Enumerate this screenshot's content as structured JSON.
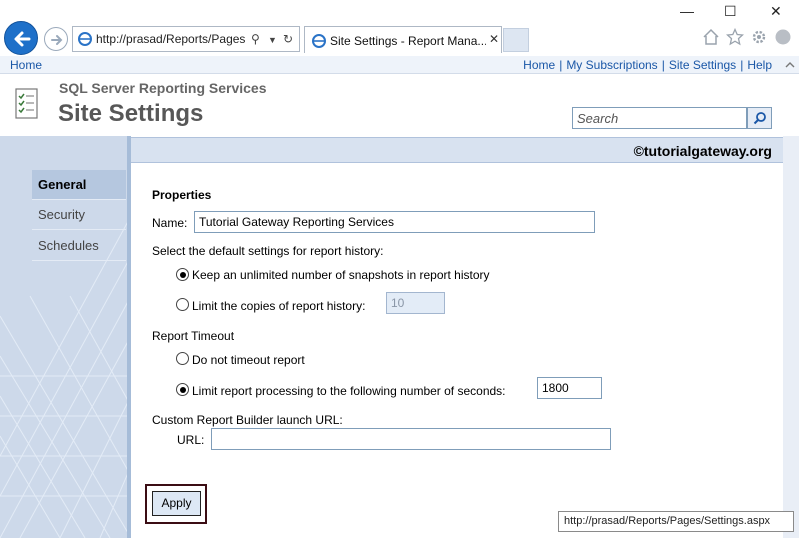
{
  "browser": {
    "address_url": "http://prasad/Reports/Pages",
    "tab_title": "Site Settings - Report Mana...",
    "status_url": "http://prasad/Reports/Pages/Settings.aspx"
  },
  "nav": {
    "left_link": "Home",
    "right_links": [
      "Home",
      "My Subscriptions",
      "Site Settings",
      "Help"
    ]
  },
  "header": {
    "product": "SQL Server Reporting Services",
    "title": "Site Settings",
    "search_placeholder": "Search"
  },
  "sidebar": {
    "items": [
      {
        "label": "General",
        "active": true
      },
      {
        "label": "Security",
        "active": false
      },
      {
        "label": "Schedules",
        "active": false
      }
    ]
  },
  "banner": {
    "watermark": "©tutorialgateway.org"
  },
  "form": {
    "section_title": "Properties",
    "name_label": "Name:",
    "name_value": "Tutorial Gateway Reporting Services",
    "history_label": "Select the default settings for report history:",
    "history_opt_unlimited": "Keep an unlimited number of snapshots in report history",
    "history_opt_limit": "Limit the copies of report history:",
    "history_limit_value": "10",
    "timeout_label": "Report Timeout",
    "timeout_opt_none": "Do not timeout report",
    "timeout_opt_limit": "Limit report processing to the following number of seconds:",
    "timeout_seconds": "1800",
    "builder_label": "Custom Report Builder launch URL:",
    "url_label": "URL:",
    "url_value": "",
    "apply_label": "Apply"
  }
}
